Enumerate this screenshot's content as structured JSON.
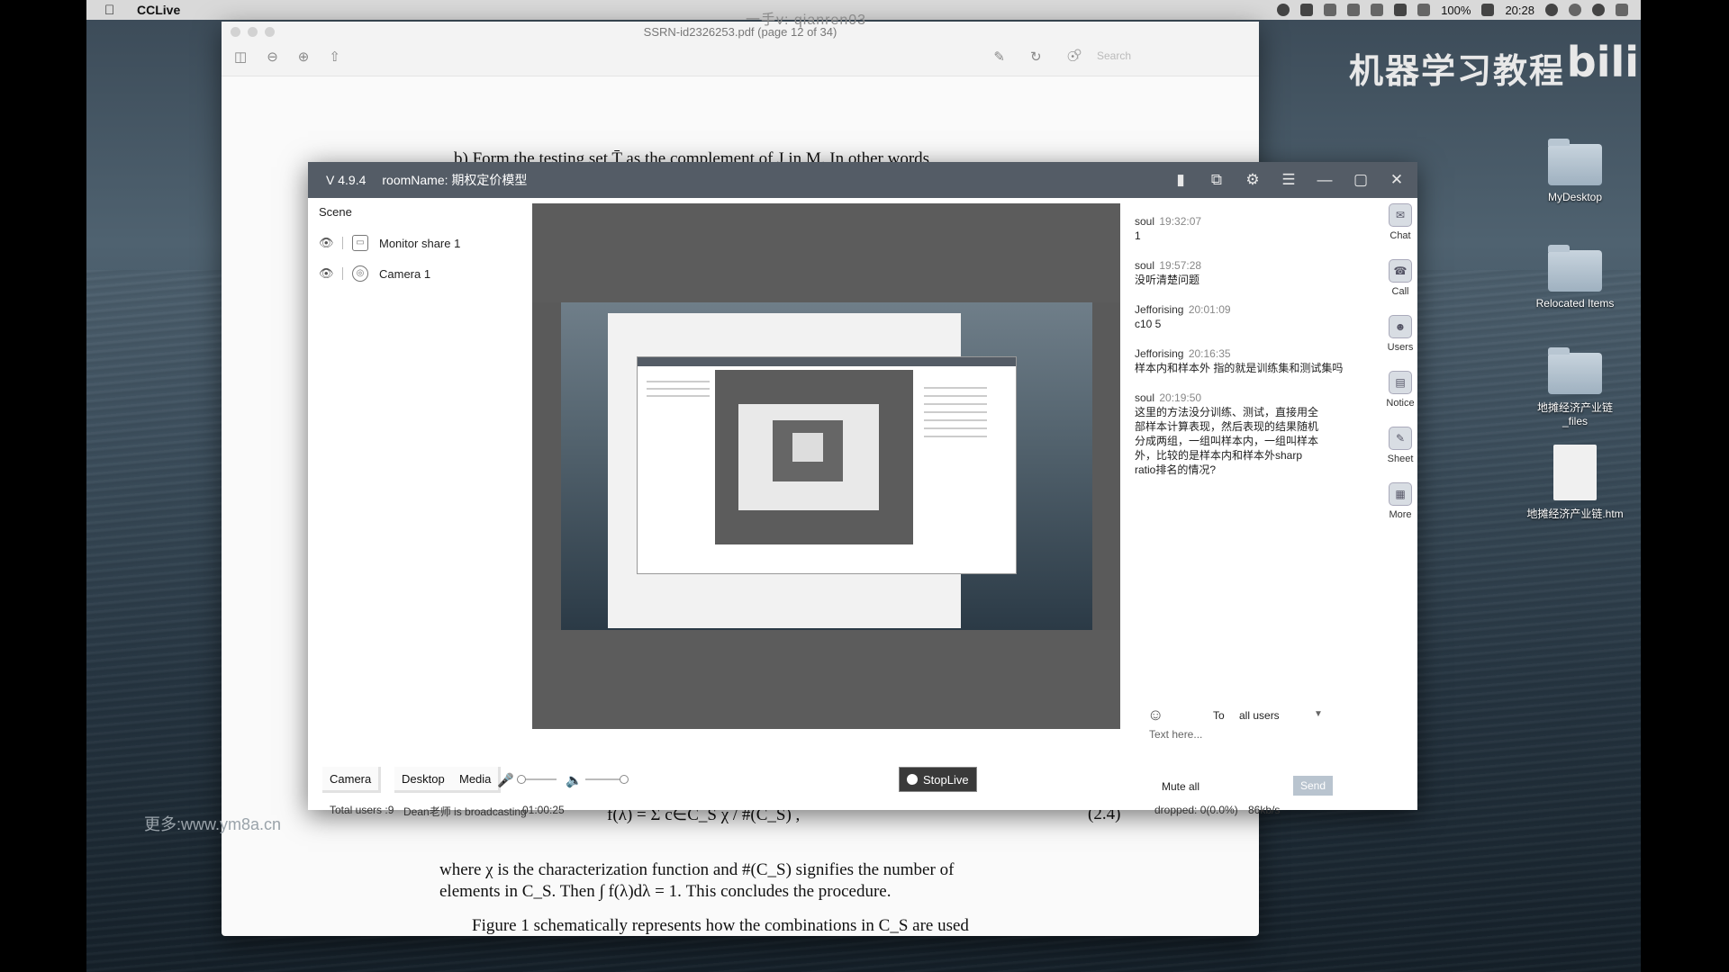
{
  "menubar": {
    "app_name": "CCLive",
    "battery": "100%",
    "clock": "20:28"
  },
  "watermarks": {
    "top": "一手v: qianren03",
    "left": "更多:www.ym8a.cn",
    "brand": "机器学习教程",
    "bili": "bili"
  },
  "pdf": {
    "title": "SSRN-id2326253.pdf (page 12 of 34)",
    "search_placeholder": "Search",
    "line_b": "b) Form the testing set T̄ as the complement of J in M. In other words,",
    "formula": "f(λ) = Σ c∈C_S  χ / #(C_S) ,",
    "eq_number": "(2.4)",
    "para1": "where χ is the characterization function and #(C_S) signifies the number of",
    "para2": "elements in C_S. Then ∫ f(λ)dλ = 1. This concludes the procedure.",
    "para3": "Figure 1 schematically represents how the combinations in C_S are used"
  },
  "cclive": {
    "version": "V 4.9.4",
    "room": "roomName: 期权定价模型",
    "scene_label": "Scene",
    "scenes": [
      {
        "label": "Monitor share 1"
      },
      {
        "label": "Camera 1"
      }
    ],
    "buttons": {
      "camera": "Camera",
      "desktop": "Desktop",
      "media": "Media",
      "stop_live": "StopLive",
      "send": "Send",
      "mute_all": "Mute all"
    },
    "status": {
      "total_users": "Total users :9",
      "broadcaster": "Dean老师 is broadcasting",
      "elapsed": "01:00:25",
      "dropped": "dropped: 0(0.0%)",
      "bitrate": "86kb/s"
    },
    "chat": [
      {
        "user": "soul",
        "time": "19:32:07",
        "text": "1"
      },
      {
        "user": "soul",
        "time": "19:57:28",
        "text": "没听清楚问题"
      },
      {
        "user": "Jefforising",
        "time": "20:01:09",
        "text": "c10 5"
      },
      {
        "user": "Jefforising",
        "time": "20:16:35",
        "text": "样本内和样本外 指的就是训练集和测试集吗"
      },
      {
        "user": "soul",
        "time": "20:19:50",
        "text": "这里的方法没分训练、测试，直接用全部样本计算表现，然后表现的结果随机分成两组，一组叫样本内，一组叫样本外，比较的是样本内和样本外sharp ratio排名的情况?"
      }
    ],
    "to_label": "To",
    "to_value": "all users",
    "text_placeholder": "Text here...",
    "side_tabs": [
      "Chat",
      "Call",
      "Users",
      "Notice",
      "Sheet",
      "More"
    ]
  },
  "desktop_icons": [
    {
      "label": "MyDesktop"
    },
    {
      "label": "Relocated Items"
    },
    {
      "label": "地摊经济产业链_files"
    },
    {
      "label": "地摊经济产业链.htm"
    }
  ]
}
